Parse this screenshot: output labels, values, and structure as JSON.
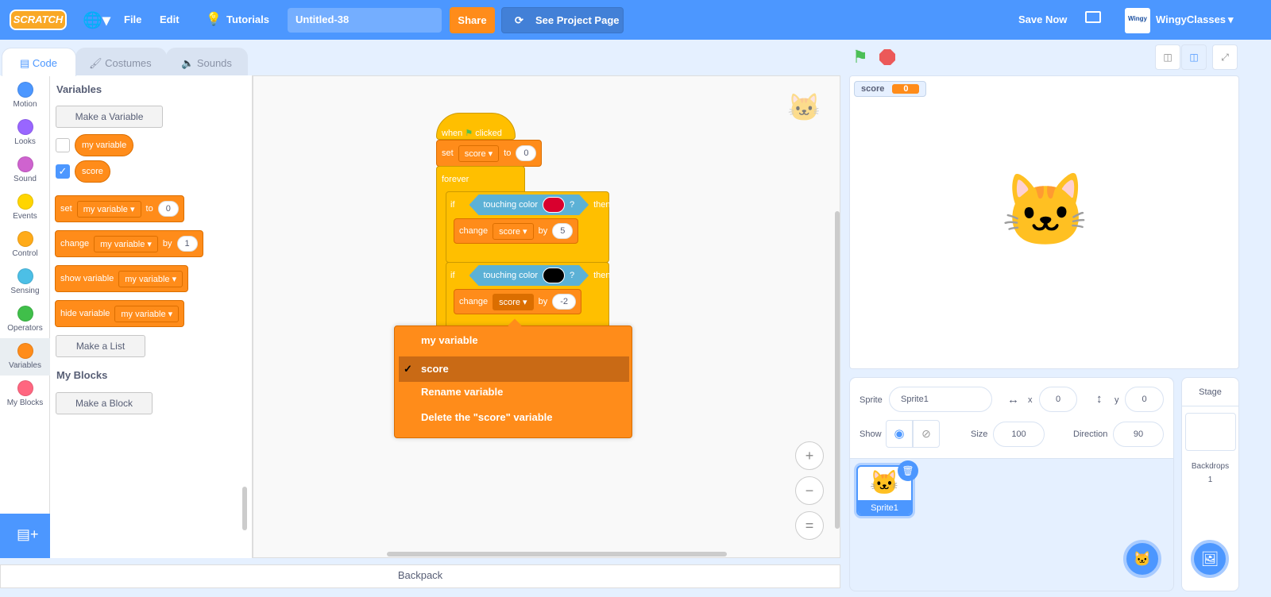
{
  "menubar": {
    "logo": "SCRATCH",
    "language_icon": "globe-icon",
    "file": "File",
    "edit": "Edit",
    "tutorials": "Tutorials",
    "project_title": "Untitled-38",
    "share": "Share",
    "see_project_page": "See Project Page",
    "save_now": "Save Now",
    "username": "WingyClasses",
    "avatar_text": "Wingy"
  },
  "tabs": [
    {
      "label": "Code"
    },
    {
      "label": "Costumes"
    },
    {
      "label": "Sounds"
    }
  ],
  "categories": [
    {
      "label": "Motion",
      "color": "#4c97ff"
    },
    {
      "label": "Looks",
      "color": "#9966ff"
    },
    {
      "label": "Sound",
      "color": "#cf63cf"
    },
    {
      "label": "Events",
      "color": "#ffd500"
    },
    {
      "label": "Control",
      "color": "#ffab19"
    },
    {
      "label": "Sensing",
      "color": "#4cbfe6"
    },
    {
      "label": "Operators",
      "color": "#40bf4a"
    },
    {
      "label": "Variables",
      "color": "#ff8c1a"
    },
    {
      "label": "My Blocks",
      "color": "#ff6680"
    }
  ],
  "palette": {
    "heading_variables": "Variables",
    "make_variable": "Make a Variable",
    "variables": [
      {
        "name": "my variable",
        "checked": false
      },
      {
        "name": "score",
        "checked": true
      }
    ],
    "set_block": {
      "op": "set",
      "var": "my variable",
      "to": "to",
      "value": "0"
    },
    "change_block": {
      "op": "change",
      "var": "my variable",
      "by": "by",
      "value": "1"
    },
    "show_block": {
      "op": "show variable",
      "var": "my variable"
    },
    "hide_block": {
      "op": "hide variable",
      "var": "my variable"
    },
    "make_list": "Make a List",
    "heading_myblocks": "My Blocks",
    "make_block": "Make a Block"
  },
  "script": {
    "hat": {
      "when": "when",
      "clicked": "clicked"
    },
    "set": {
      "op": "set",
      "var": "score",
      "to": "to",
      "value": "0"
    },
    "forever": "forever",
    "if1": {
      "if": "if",
      "cond": "touching color",
      "q": "?",
      "then": "then",
      "color": "#d9002e",
      "change": "change",
      "var": "score",
      "by": "by",
      "value": "5"
    },
    "if2": {
      "if": "if",
      "cond": "touching color",
      "q": "?",
      "then": "then",
      "color": "#000000",
      "change": "change",
      "var": "score",
      "by": "by",
      "value": "-2"
    }
  },
  "dropdown_menu": {
    "items": [
      {
        "label": "my variable",
        "selected": false
      },
      {
        "label": "score",
        "selected": true
      },
      {
        "label": "Rename variable",
        "selected": false
      },
      {
        "label": "Delete the \"score\" variable",
        "selected": false
      }
    ],
    "check": "✓"
  },
  "zoom_controls": {
    "zoom_in": "+",
    "zoom_out": "−",
    "reset": "="
  },
  "backpack": "Backpack",
  "stage": {
    "monitor_label": "score",
    "monitor_value": "0"
  },
  "sprite_info": {
    "sprite_label": "Sprite",
    "sprite_name": "Sprite1",
    "x_label": "x",
    "x": "0",
    "y_label": "y",
    "y": "0",
    "show_label": "Show",
    "size_label": "Size",
    "size": "100",
    "direction_label": "Direction",
    "direction": "90"
  },
  "sprites": [
    {
      "name": "Sprite1",
      "selected": true
    }
  ],
  "stage_panel": {
    "title": "Stage",
    "backdrops_label": "Backdrops",
    "backdrops_count": "1"
  },
  "colors": {
    "menubar": "#4c97ff",
    "variables": "#ff8c1a",
    "events": "#ffbf00",
    "sensing": "#5cb1d6"
  }
}
